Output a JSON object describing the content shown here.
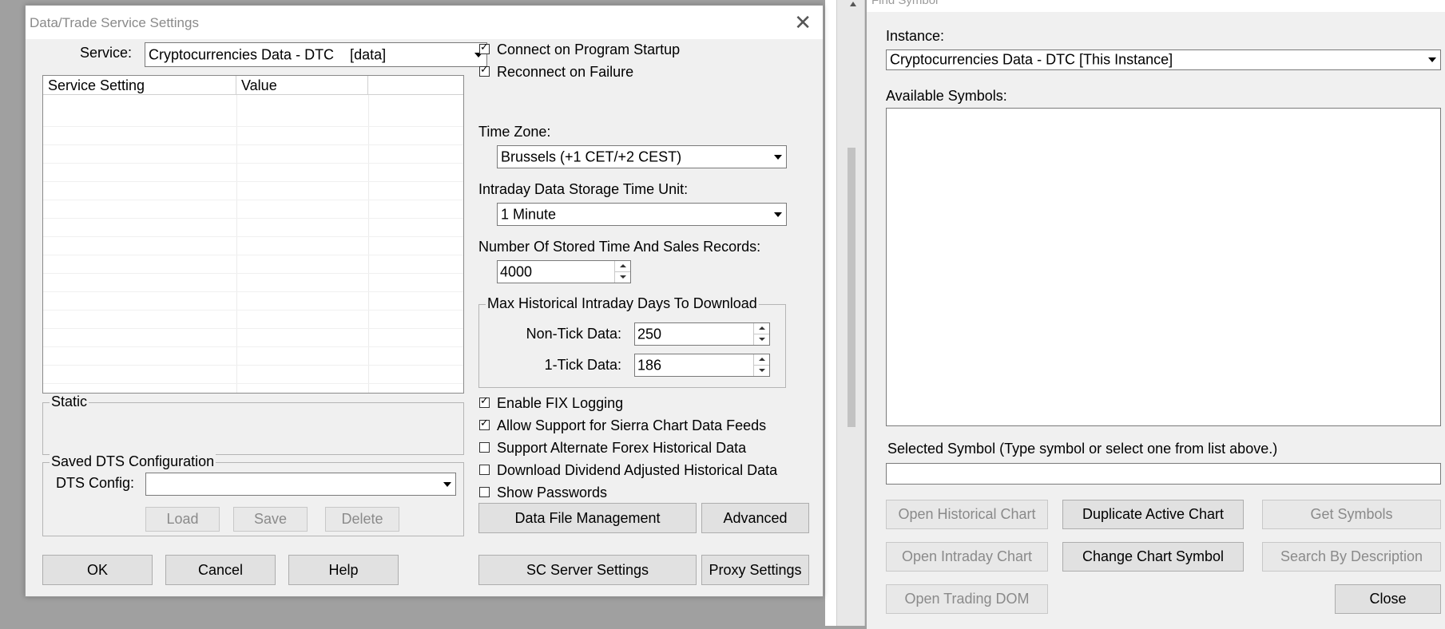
{
  "settings_dialog": {
    "title": "Data/Trade Service Settings",
    "service_label": "Service:",
    "service_value": "Cryptocurrencies Data - DTC    [data]",
    "grid_headers": [
      "Service Setting",
      "Value",
      ""
    ],
    "static_label": "Static",
    "saved_dts_label": "Saved DTS Configuration",
    "dts_config_label": "DTS Config:",
    "dts_config_value": "",
    "load_label": "Load",
    "save_label": "Save",
    "delete_label": "Delete",
    "ok_label": "OK",
    "cancel_label": "Cancel",
    "help_label": "Help",
    "connect_startup": {
      "label": "Connect on Program Startup",
      "checked": true
    },
    "reconnect_failure": {
      "label": "Reconnect on Failure",
      "checked": true
    },
    "time_zone_label": "Time Zone:",
    "time_zone_value": "Brussels (+1 CET/+2 CEST)",
    "intraday_unit_label": "Intraday Data Storage Time Unit:",
    "intraday_unit_value": "1 Minute",
    "ts_records_label": "Number Of Stored Time And Sales Records:",
    "ts_records_value": "4000",
    "max_hist_label": "Max Historical Intraday Days To Download",
    "non_tick_label": "Non-Tick Data:",
    "non_tick_value": "250",
    "one_tick_label": "1-Tick Data:",
    "one_tick_value": "186",
    "enable_fix": {
      "label": "Enable FIX Logging",
      "checked": true
    },
    "allow_sierra": {
      "label": "Allow Support for Sierra Chart Data Feeds",
      "checked": true
    },
    "alt_forex": {
      "label": "Support Alternate Forex Historical Data",
      "checked": false
    },
    "dividend_adj": {
      "label": "Download Dividend Adjusted Historical Data",
      "checked": false
    },
    "show_passwords": {
      "label": "Show Passwords",
      "checked": false
    },
    "data_file_mgmt_label": "Data File Management",
    "advanced_label": "Advanced",
    "sc_server_label": "SC Server Settings",
    "proxy_label": "Proxy Settings"
  },
  "find_symbol": {
    "title": "Find Symbol",
    "instance_label": "Instance:",
    "instance_value": "Cryptocurrencies Data - DTC [This Instance]",
    "available_label": "Available Symbols:",
    "selected_label": "Selected Symbol (Type symbol or select one from list above.)",
    "selected_value": "",
    "open_hist_label": "Open Historical Chart",
    "dup_chart_label": "Duplicate Active Chart",
    "get_symbols_label": "Get Symbols",
    "open_intraday_label": "Open Intraday Chart",
    "change_symbol_label": "Change Chart Symbol",
    "search_desc_label": "Search By Description",
    "open_dom_label": "Open Trading DOM",
    "close_label": "Close"
  }
}
